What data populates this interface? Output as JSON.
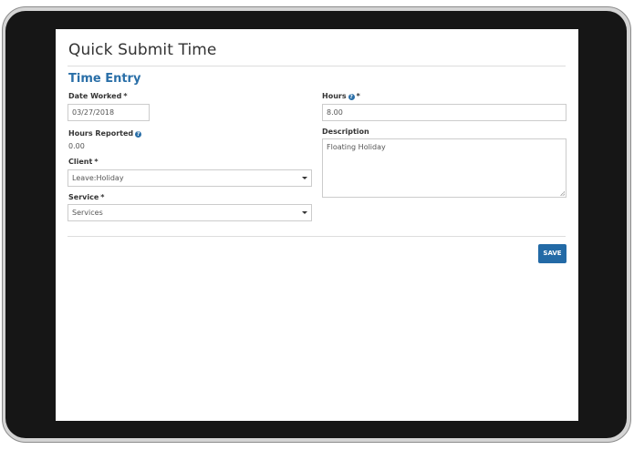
{
  "page": {
    "title": "Quick Submit Time",
    "section_title": "Time Entry"
  },
  "form": {
    "date_worked": {
      "label": "Date Worked",
      "required_mark": "*",
      "value": "03/27/2018"
    },
    "hours": {
      "label": "Hours",
      "required_mark": "*",
      "value": "8.00",
      "help_icon": "question-circle-icon"
    },
    "hours_reported": {
      "label": "Hours Reported",
      "value": "0.00",
      "help_icon": "question-circle-icon"
    },
    "description": {
      "label": "Description",
      "value": "Floating Holiday"
    },
    "client": {
      "label": "Client",
      "required_mark": "*",
      "selected": "Leave:Holiday"
    },
    "service": {
      "label": "Service",
      "required_mark": "*",
      "selected": "Services"
    }
  },
  "actions": {
    "save_label": "SAVE"
  },
  "colors": {
    "accent": "#2a6fa8",
    "save_button": "#236aa6",
    "device_frame": "#161616"
  }
}
